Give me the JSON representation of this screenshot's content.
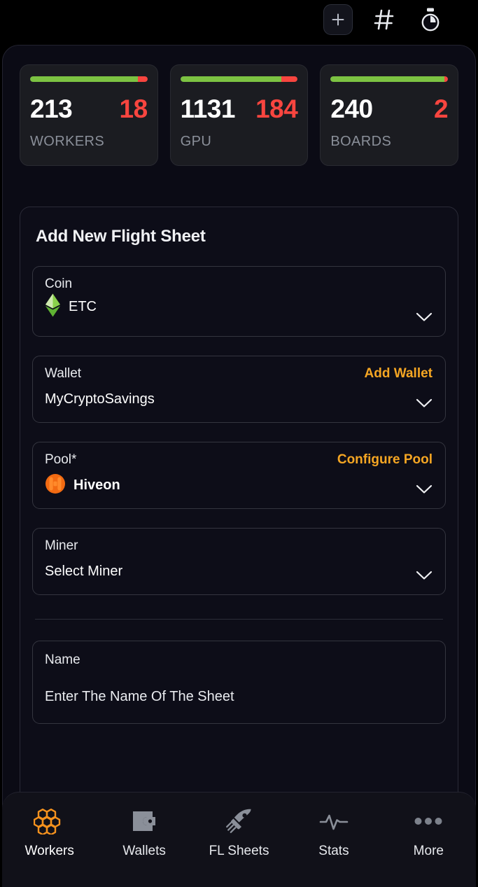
{
  "topbar": {
    "icons": [
      {
        "name": "add-icon",
        "label": "+"
      },
      {
        "name": "hash-icon",
        "label": "#"
      },
      {
        "name": "timer-icon",
        "label": "timer"
      }
    ]
  },
  "stats": [
    {
      "ok": "213",
      "bad": "18",
      "label": "WORKERS",
      "ok_pct": 92,
      "bad_pct": 8,
      "ok_color": "#7cc242",
      "bad_color": "#f8453f"
    },
    {
      "ok": "1131",
      "bad": "184",
      "label": "GPU",
      "ok_pct": 86,
      "bad_pct": 14,
      "ok_color": "#7cc242",
      "bad_color": "#f8453f"
    },
    {
      "ok": "240",
      "bad": "2",
      "label": "BOARDS",
      "ok_pct": 97,
      "bad_pct": 3,
      "ok_color": "#7cc242",
      "bad_color": "#f8453f"
    }
  ],
  "form": {
    "title": "Add New Flight Sheet",
    "coin": {
      "label": "Coin",
      "value": "ETC",
      "icon": "etc-coin-icon"
    },
    "wallet": {
      "label": "Wallet",
      "action": "Add Wallet",
      "value": "MyCryptoSavings"
    },
    "pool": {
      "label": "Pool*",
      "action": "Configure Pool",
      "value": "Hiveon",
      "icon": "hiveon-logo-icon"
    },
    "miner": {
      "label": "Miner",
      "value": "Select Miner"
    },
    "name": {
      "label": "Name",
      "placeholder": "Enter The Name Of The Sheet",
      "value": ""
    }
  },
  "bottom_nav": {
    "items": [
      {
        "label": "Workers",
        "icon": "honeycomb-icon",
        "active": true
      },
      {
        "label": "Wallets",
        "icon": "wallet-icon",
        "active": false
      },
      {
        "label": "FL Sheets",
        "icon": "rocket-icon",
        "active": false
      },
      {
        "label": "Stats",
        "icon": "pulse-icon",
        "active": false
      },
      {
        "label": "More",
        "icon": "ellipsis-icon",
        "active": false
      }
    ]
  },
  "colors": {
    "accent_orange": "#f5a623",
    "green": "#7cc242",
    "red": "#f8453f",
    "page_bg": "#000000",
    "panel_bg": "#0b0b15"
  }
}
